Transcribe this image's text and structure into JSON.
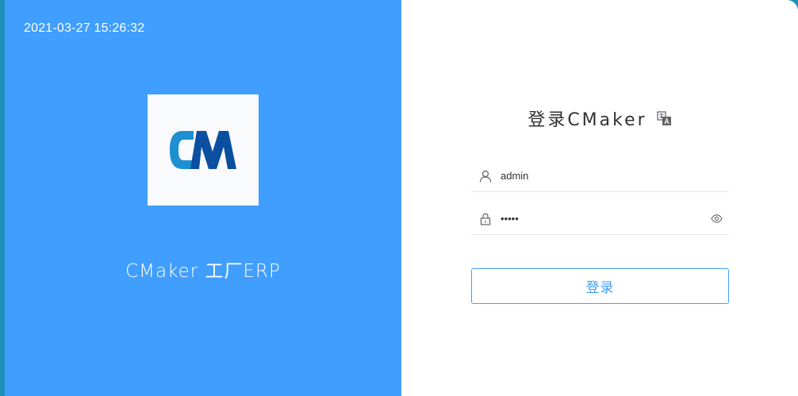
{
  "left": {
    "datetime": "2021-03-27 15:26:32",
    "logo_text": "CM",
    "app_name": "CMaker 工厂ERP"
  },
  "login": {
    "title": "登录CMaker",
    "username": {
      "value": "admin",
      "placeholder": ""
    },
    "password": {
      "value": "admin",
      "placeholder": ""
    },
    "submit_label": "登录"
  },
  "icons": {
    "user": "user-icon",
    "lock": "lock-icon",
    "eye": "eye-icon",
    "language": "translate-icon"
  },
  "colors": {
    "primary": "#409eff",
    "logo_light": "#1e8fd0",
    "logo_dark": "#0b4fa0"
  }
}
